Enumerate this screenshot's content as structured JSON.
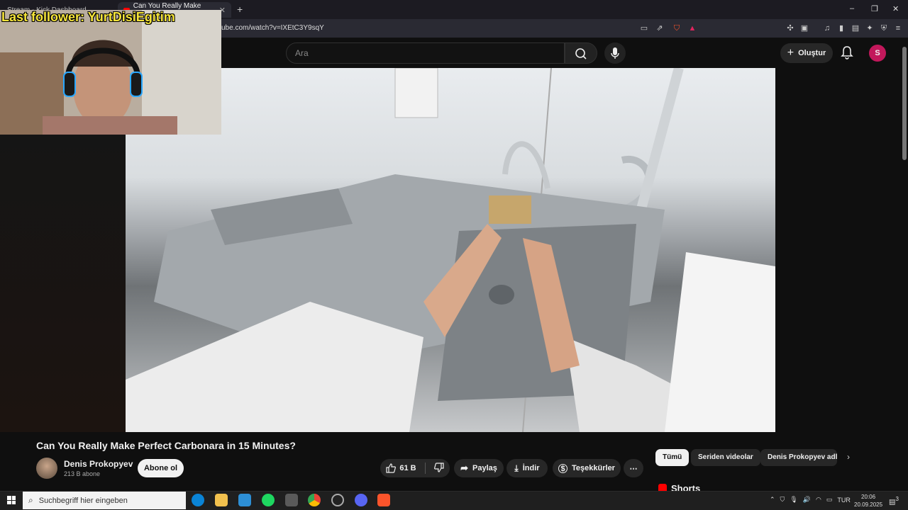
{
  "browser": {
    "tabs": [
      {
        "label": "Stream - Kick Dashboard"
      },
      {
        "label": "Can You Really Make Perfect..."
      }
    ],
    "new_tab_label": "+",
    "url": "ube.com/watch?v=IXEtC3Y9sqY",
    "window_controls": [
      "–",
      "❐",
      "✕"
    ]
  },
  "youtube": {
    "search_placeholder": "Ara",
    "create_label": "Oluştur",
    "avatar_letter": "S"
  },
  "stream_overlay": {
    "follower_text": "Last follower: YurtDisiEgitim"
  },
  "video": {
    "title": "Can You Really Make Perfect Carbonara in 15 Minutes?",
    "channel_name": "Denis Prokopyev",
    "channel_subs": "213 B abone",
    "subscribe_label": "Abone ol",
    "likes": "61 B",
    "share_label": "Paylaş",
    "download_label": "İndir",
    "thanks_label": "Teşekkürler",
    "more_label": "⋯"
  },
  "sidebar": {
    "chips": [
      "Tümü",
      "Seriden videolar",
      "Denis Prokopyev adlı"
    ],
    "shorts_label": "Shorts"
  },
  "taskbar": {
    "search_placeholder": "Suchbegriff hier eingeben",
    "language": "TUR",
    "time": "20:06",
    "date": "20.09.2025",
    "notifications": "3"
  },
  "colors": {
    "yt_bg": "#0f0f0f",
    "follower_text": "#f6e53a",
    "avatar": "#c2185b",
    "subscribe_bg": "#f1f1f1"
  }
}
